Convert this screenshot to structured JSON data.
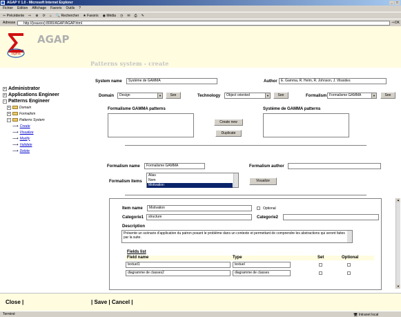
{
  "window": {
    "title": "AGAP V 1.0 - Microsoft Internet Explorer"
  },
  "menu": [
    "Fichier",
    "Edition",
    "Affichage",
    "Favoris",
    "Outils",
    "?"
  ],
  "toolbar": {
    "back": "Précédente",
    "search": "Rechercher",
    "favorites": "Favoris",
    "media": "Média"
  },
  "address": {
    "label": "Adresse",
    "url": "http://(eauxxx):8000/AGAP/AGAP.html",
    "go": "OK"
  },
  "brand": {
    "name": "AGAP"
  },
  "page": {
    "title": "Patterns system - create"
  },
  "tree": {
    "administrator": "Administrator",
    "applications_engineer": "Applications Engineer",
    "patterns_engineer": "Patterns Engineer",
    "domain": "Domain",
    "formalism": "Formalism",
    "patterns_system": "Patterns System",
    "actions": [
      "Create",
      "Visualize",
      "Modify",
      "Validate",
      "Delete"
    ]
  },
  "form": {
    "system_name_label": "System name",
    "system_name_value": "Système de GAMMA",
    "author_label": "Author",
    "author_value": "E. Gamma, R. Helm, R. Johnson, J. Vlissides",
    "domain_label": "Domain",
    "domain_value": "Design",
    "see_label": "See",
    "technology_label": "Technology",
    "technology_value": "Object oriented",
    "formalism_label": "Formalism",
    "formalism_value": "Formalisme GAMMA",
    "list1_title": "Formalisme GAMMA patterns",
    "list2_title": "Système de GAMMA patterns",
    "create_new_label": "Create new",
    "duplicate_label": "Duplicate",
    "formalism_name_label": "Formalism name",
    "formalism_name_value": "Formalisme GAMMA",
    "formalism_author_label": "Formalism author",
    "formalism_author_value": "",
    "formalism_items_label": "Formalism items",
    "formalism_items": [
      "Alias",
      "Nom",
      "Motivation"
    ],
    "formalism_items_selected": "Motivation",
    "visualize_label": "Visualize"
  },
  "item": {
    "item_name_label": "Item name",
    "item_name_value": "Motivation",
    "optional_label": "Optional",
    "category1_label": "Categorie1",
    "category1_value": "structure",
    "category2_label": "Categorie2",
    "category2_value": "",
    "description_label": "Description",
    "description_value": "Présente un scénario d'application du patron posant le problème dans un contexte et permettant de comprendre les abstractions qui seront faites par la suite.",
    "fields_list_label": "Fields list",
    "col_field_name": "Field name",
    "col_type": "Type",
    "col_set": "Set",
    "col_optional": "Optional",
    "fields": [
      {
        "name": "textuel1",
        "type": "textuel"
      },
      {
        "name": "diagramme de classes2",
        "type": "diagramme de classes"
      }
    ]
  },
  "footer": {
    "close_label": "Close |",
    "save_label": "| Save |",
    "cancel_label": "Cancel |"
  },
  "status": {
    "left": "Terminé",
    "zone": "Intranet local"
  }
}
